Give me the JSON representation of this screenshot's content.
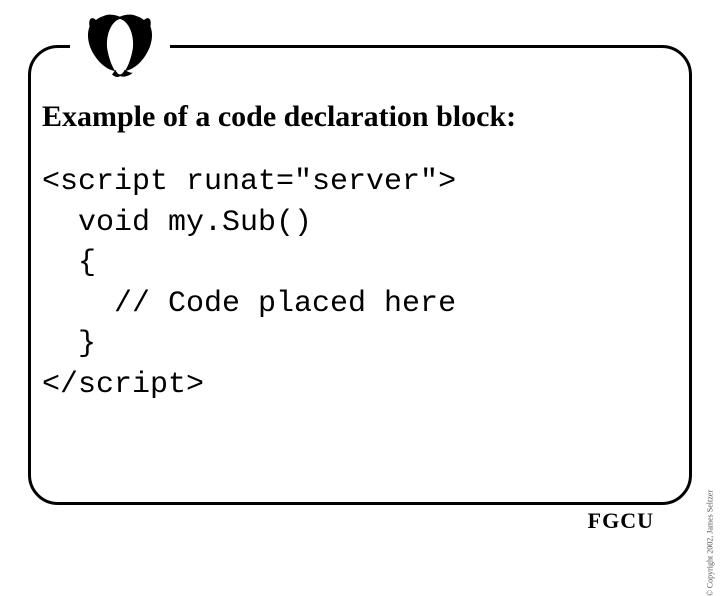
{
  "heading": "Example of a code declaration block:",
  "code_lines": [
    "<script runat=\"server\">",
    "  void my.Sub()",
    "  {",
    "    // Code placed here",
    "  }",
    "</script>"
  ],
  "footer": "FGCU",
  "copyright": "© Copyright 2002, James Seltzer"
}
